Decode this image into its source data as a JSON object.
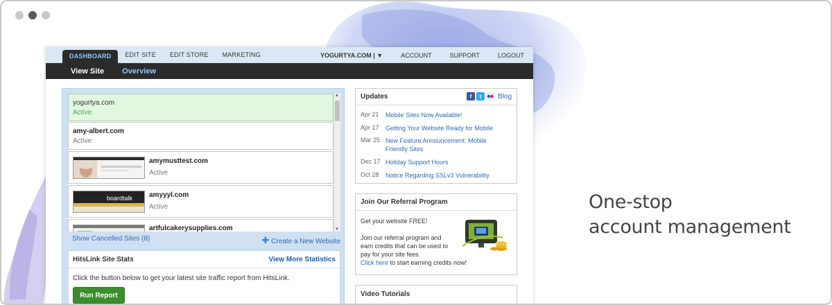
{
  "window": {
    "dots": [
      "close",
      "minimize",
      "zoom"
    ]
  },
  "nav": {
    "tabs": [
      "DASHBOARD",
      "EDIT SITE",
      "EDIT STORE",
      "MARKETING"
    ],
    "active_tab": "DASHBOARD",
    "site_selector": "YOGURTYA.COM | ▼",
    "right_links": [
      "ACCOUNT",
      "SUPPORT",
      "LOGOUT"
    ]
  },
  "subnav": {
    "view_site": "View Site",
    "overview": "Overview"
  },
  "sites": [
    {
      "name": "yogurtya.com",
      "status": "Active",
      "selected": true
    },
    {
      "name": "amy-albert.com",
      "status": "Active"
    },
    {
      "name": "amymusttest.com",
      "status": "Active"
    },
    {
      "name": "amyyyl.com",
      "status": "Active"
    },
    {
      "name": "artfulcakerysupplies.com",
      "status": ""
    }
  ],
  "thumb_text": "boardtalk",
  "list_footer": {
    "cancelled": "Show Cancelled Sites (8)",
    "create": "Create a New Website"
  },
  "stats": {
    "title": "HitsLink Site Stats",
    "more": "View More Statistics",
    "text": "Click the button below to get your latest site traffic report from HitsLink.",
    "button": "Run Report"
  },
  "updates": {
    "title": "Updates",
    "blog": "Blog",
    "items": [
      {
        "date": "Apr 21",
        "text": "Mobile Sites Now Available!"
      },
      {
        "date": "Apr 17",
        "text": "Getting Your Website Ready for Mobile"
      },
      {
        "date": "Mar 25",
        "text": "New Feature Announcement: Mobile Friendly Sites"
      },
      {
        "date": "Dec 17",
        "text": "Holiday Support Hours"
      },
      {
        "date": "Oct 28",
        "text": "Notice Regarding SSLv3 Vulnerability"
      }
    ]
  },
  "referral": {
    "title": "Join Our Referral Program",
    "line1": "Get your website FREE!",
    "line2": "Join our referral program and",
    "line3": "earn credits that can be used to",
    "line4": "pay for your site fees.",
    "link": "Click here",
    "rest": " to start earning credits now!"
  },
  "video": {
    "title": "Video Tutorials"
  },
  "tagline": {
    "line1": "One-stop",
    "line2": "account management"
  },
  "colors": {
    "accent": "#2f6ab0",
    "nav_dark": "#2b2b2b",
    "active_tab_text": "#8fc9ff",
    "run_button": "#3c8d2e"
  }
}
